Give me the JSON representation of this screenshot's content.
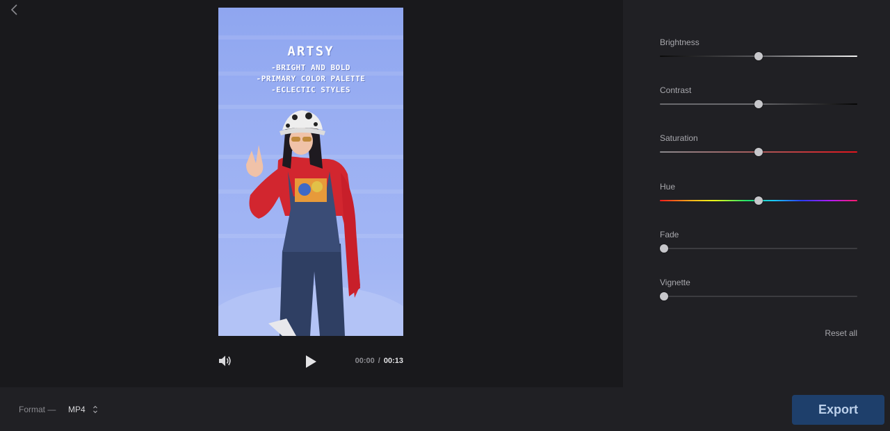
{
  "navigation": {
    "back_icon": "chevron-left-icon"
  },
  "video": {
    "overlay_title": "ARTSY",
    "overlay_lines": [
      "-BRIGHT AND BOLD",
      "-PRIMARY COLOR PALETTE",
      "-ECLECTIC STYLES"
    ]
  },
  "player": {
    "volume_icon": "volume-icon",
    "play_icon": "play-icon",
    "current_time": "00:00",
    "separator": "/",
    "duration": "00:13"
  },
  "adjustments": [
    {
      "label": "Brightness",
      "value": 0.5,
      "track": "brightness-gradient"
    },
    {
      "label": "Contrast",
      "value": 0.5,
      "track": "contrast-gradient"
    },
    {
      "label": "Saturation",
      "value": 0.5,
      "track": "saturation-gradient"
    },
    {
      "label": "Hue",
      "value": 0.5,
      "track": "hue-spectrum"
    },
    {
      "label": "Fade",
      "value": 0.0,
      "track": "plain"
    },
    {
      "label": "Vignette",
      "value": 0.0,
      "track": "plain"
    }
  ],
  "reset_label": "Reset all",
  "format": {
    "label": "Format —",
    "value": "MP4",
    "icon": "sort-arrows-icon"
  },
  "export_label": "Export",
  "colors": {
    "accent": "#1e3f6b",
    "export_text": "#bcd0ea",
    "panel": "#202024",
    "background": "#19191c"
  }
}
